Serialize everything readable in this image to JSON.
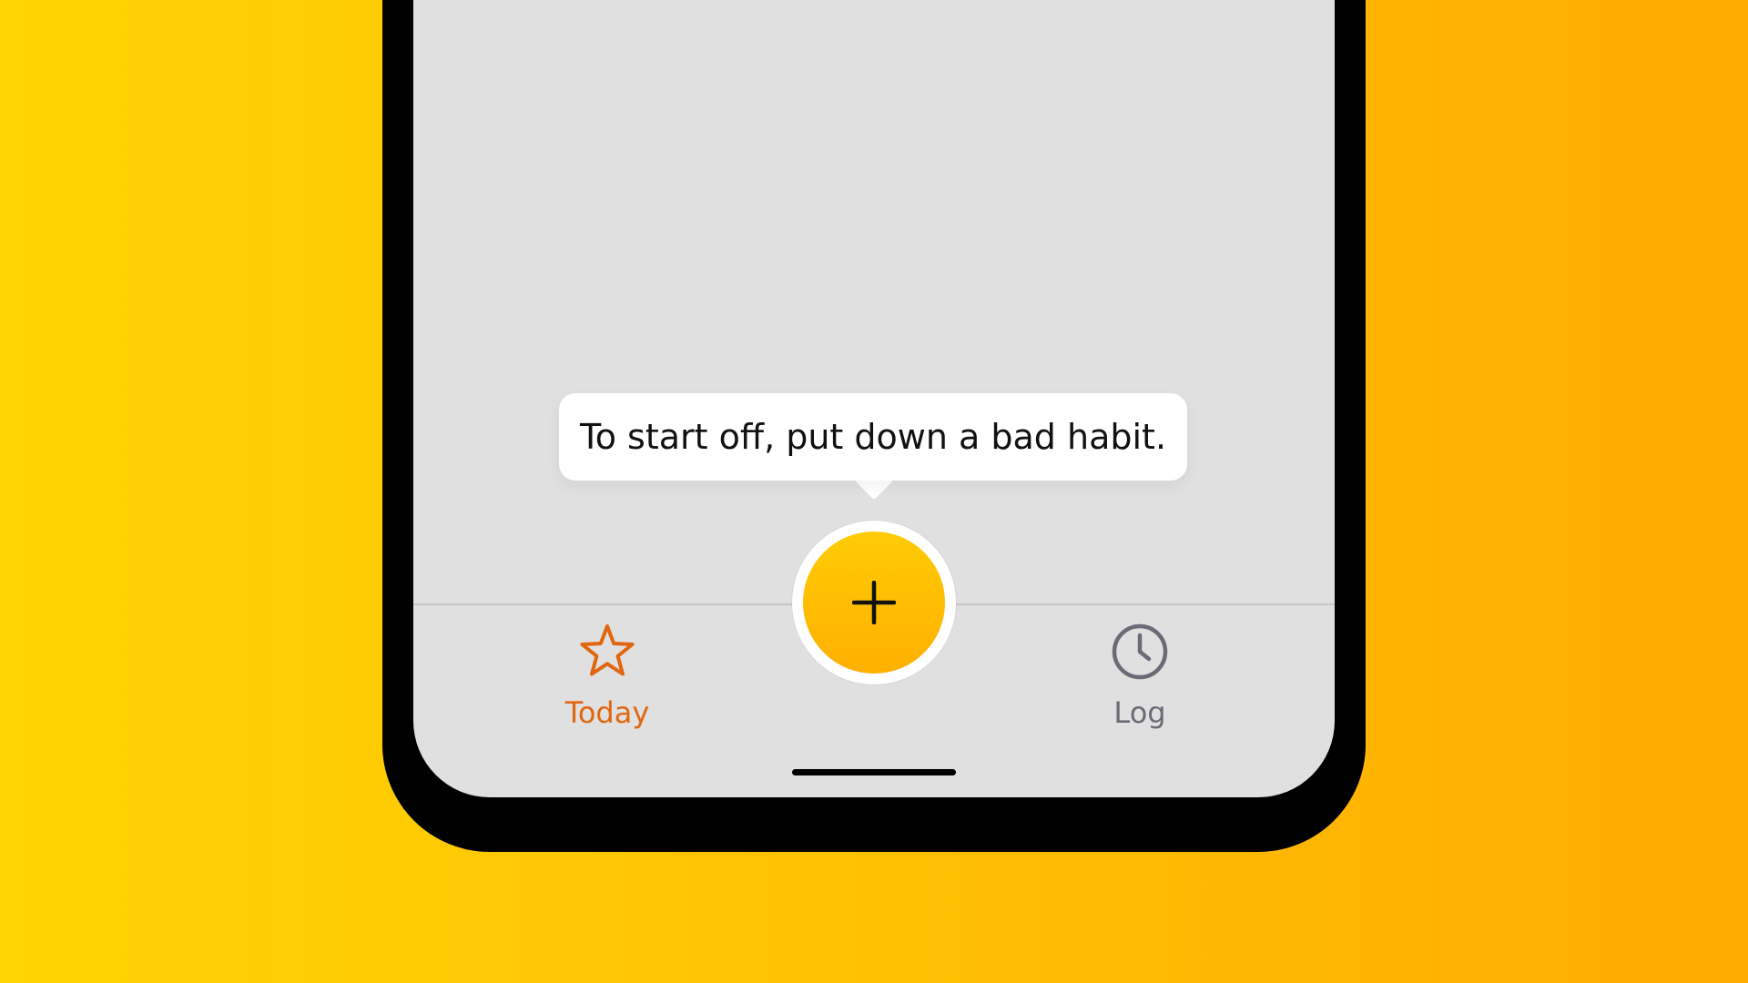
{
  "background": {
    "gradient_start": "#FFD402",
    "gradient_end": "#FFAB00"
  },
  "tooltip": {
    "text": "To start off, put down a bad habit."
  },
  "add_button": {
    "icon": "plus-icon",
    "color": "#FFC000"
  },
  "tab_bar": {
    "tabs": [
      {
        "label": "Today",
        "icon": "star-icon",
        "active": true,
        "color": "#E0660F"
      },
      {
        "label": "Log",
        "icon": "clock-icon",
        "active": false,
        "color": "#6B6B78"
      }
    ]
  }
}
